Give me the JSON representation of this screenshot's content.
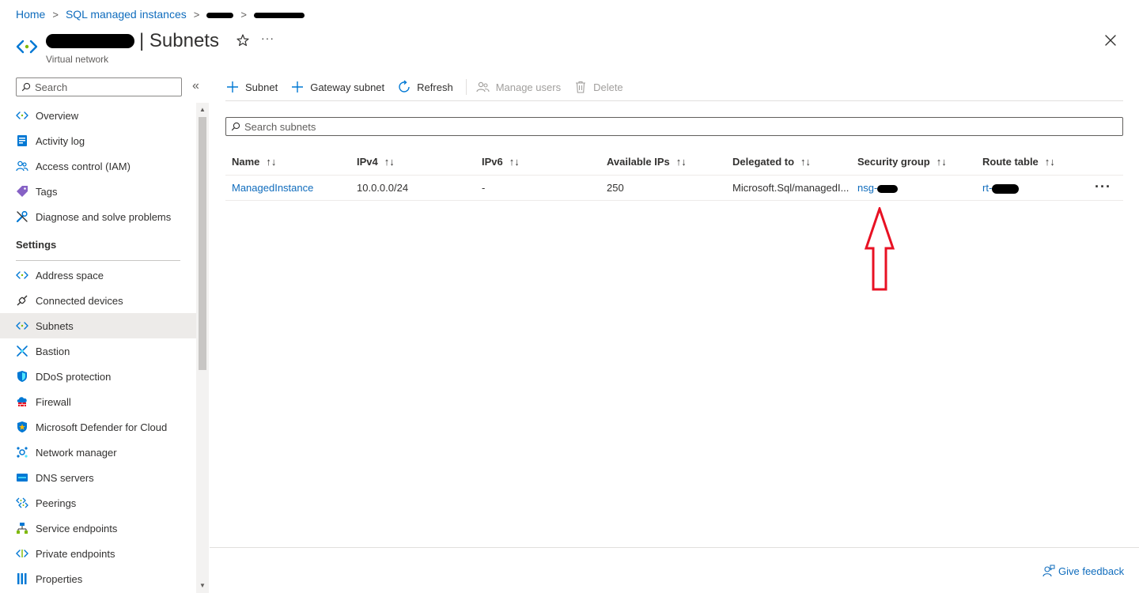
{
  "breadcrumb": {
    "items": [
      "Home",
      "SQL managed instances"
    ]
  },
  "header": {
    "title": "| Subnets",
    "subtitle": "Virtual network",
    "more_label": "···"
  },
  "sidebar": {
    "search_placeholder": "Search",
    "collapse_label": "«",
    "items_top": [
      {
        "label": "Overview",
        "icon": "vnet-icon"
      },
      {
        "label": "Activity log",
        "icon": "activity-log-icon"
      },
      {
        "label": "Access control (IAM)",
        "icon": "iam-icon"
      },
      {
        "label": "Tags",
        "icon": "tag-icon"
      },
      {
        "label": "Diagnose and solve problems",
        "icon": "wrench-icon"
      }
    ],
    "settings_heading": "Settings",
    "items_settings": [
      {
        "label": "Address space",
        "icon": "vnet-icon"
      },
      {
        "label": "Connected devices",
        "icon": "plug-icon"
      },
      {
        "label": "Subnets",
        "icon": "vnet-icon",
        "selected": true
      },
      {
        "label": "Bastion",
        "icon": "bastion-icon"
      },
      {
        "label": "DDoS protection",
        "icon": "shield-icon"
      },
      {
        "label": "Firewall",
        "icon": "firewall-icon"
      },
      {
        "label": "Microsoft Defender for Cloud",
        "icon": "defender-icon"
      },
      {
        "label": "Network manager",
        "icon": "network-manager-icon"
      },
      {
        "label": "DNS servers",
        "icon": "dns-icon"
      },
      {
        "label": "Peerings",
        "icon": "peerings-icon"
      },
      {
        "label": "Service endpoints",
        "icon": "service-endpoints-icon"
      },
      {
        "label": "Private endpoints",
        "icon": "private-endpoints-icon"
      },
      {
        "label": "Properties",
        "icon": "properties-icon"
      }
    ]
  },
  "toolbar": {
    "subnet": "Subnet",
    "gateway_subnet": "Gateway subnet",
    "refresh": "Refresh",
    "manage_users": "Manage users",
    "delete": "Delete"
  },
  "main": {
    "search_placeholder": "Search subnets",
    "columns": [
      "Name",
      "IPv4",
      "IPv6",
      "Available IPs",
      "Delegated to",
      "Security group",
      "Route table"
    ],
    "sort_glyph": "↑↓",
    "rows": [
      {
        "name": "ManagedInstance",
        "ipv4": "10.0.0.0/24",
        "ipv6": "-",
        "available_ips": "250",
        "delegated_to": "Microsoft.Sql/managedI...",
        "security_group": "nsg-",
        "route_table": "rt-"
      }
    ]
  },
  "footer": {
    "feedback": "Give feedback"
  },
  "colors": {
    "link": "#0f6cbd",
    "accent": "#0078d4",
    "annotation_arrow": "#e81123",
    "selected_bg": "#edebe9"
  }
}
